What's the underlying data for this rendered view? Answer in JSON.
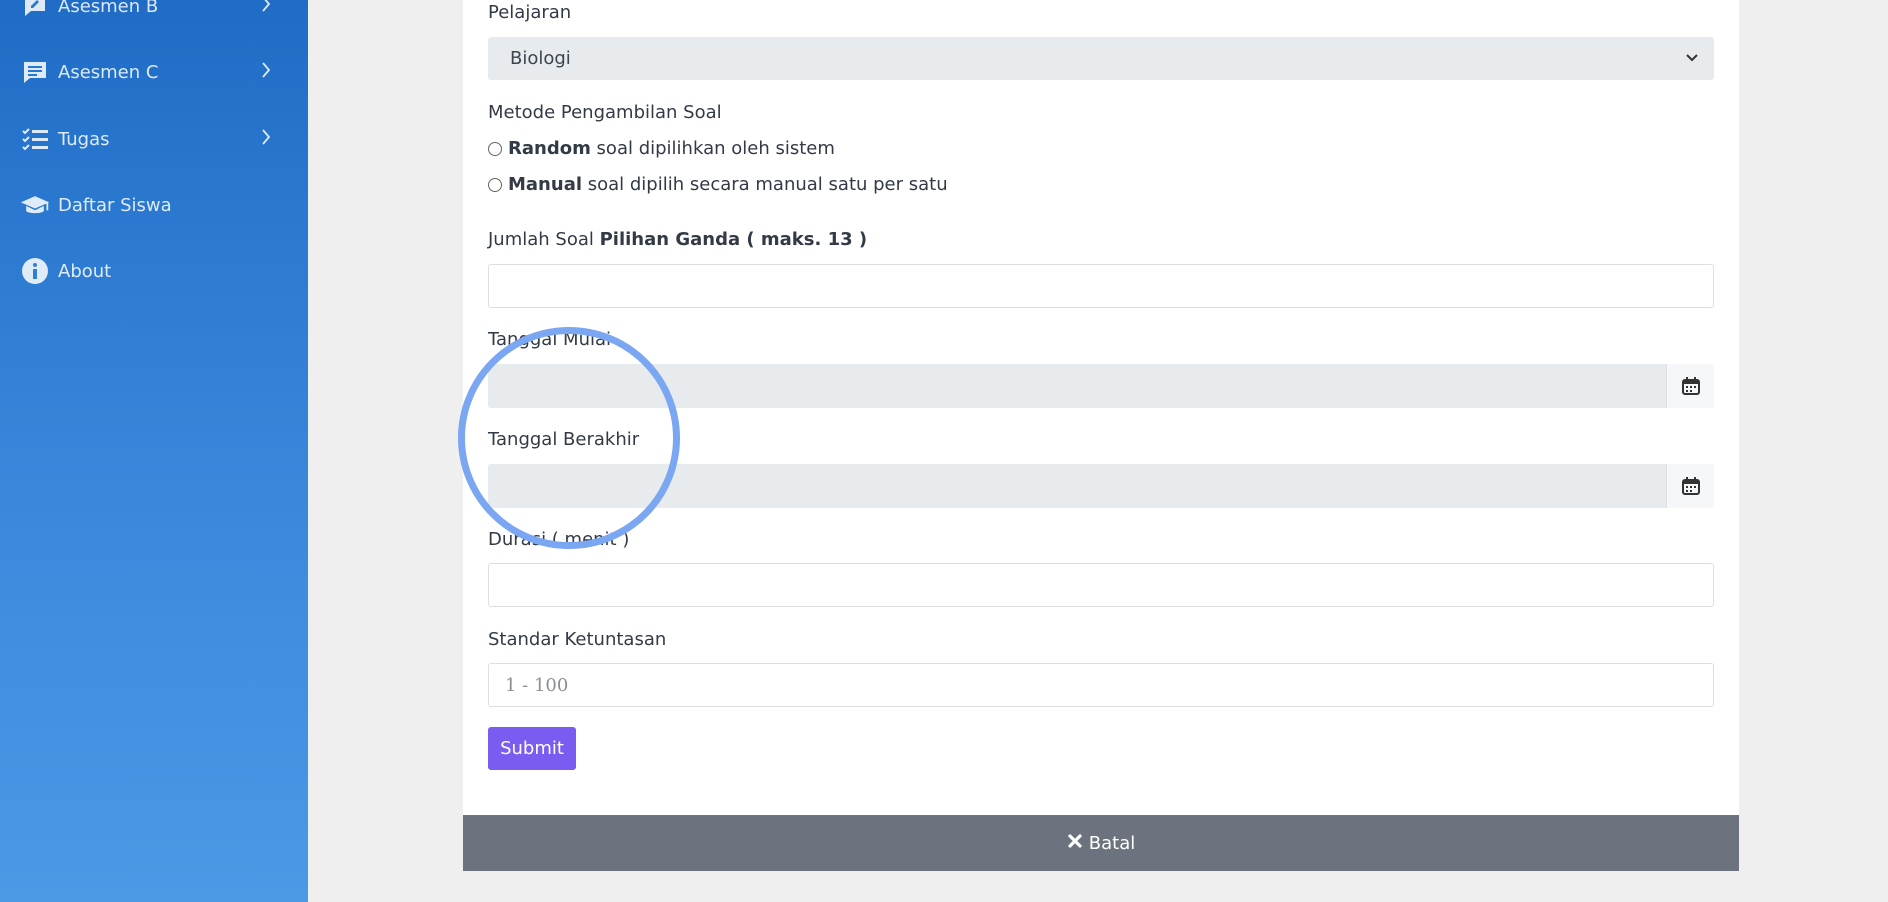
{
  "sidebar": {
    "items": [
      {
        "label": "Asesmen B",
        "icon": "edit-chat-icon",
        "has_chevron": true
      },
      {
        "label": "Asesmen C",
        "icon": "message-icon",
        "has_chevron": true
      },
      {
        "label": "Tugas",
        "icon": "checklist-icon",
        "has_chevron": true
      },
      {
        "label": "Daftar Siswa",
        "icon": "graduation-cap-icon",
        "has_chevron": false
      },
      {
        "label": "About",
        "icon": "info-icon",
        "has_chevron": false
      }
    ]
  },
  "form": {
    "pelajaran_label": "Pelajaran",
    "pelajaran_value": "Biologi",
    "metode_label": "Metode Pengambilan Soal",
    "radio_random_bold": "Random",
    "radio_random_text": " soal dipilihkan oleh sistem",
    "radio_manual_bold": "Manual",
    "radio_manual_text": " soal dipilih secara manual satu per satu",
    "jumlah_label_prefix": "Jumlah Soal ",
    "jumlah_label_bold": "Pilihan Ganda ( maks. 13 )",
    "jumlah_value": "",
    "tanggal_mulai_label": "Tanggal Mulai",
    "tanggal_berakhir_label": "Tanggal Berakhir",
    "durasi_label": "Durasi ( menit )",
    "durasi_value": "",
    "standar_label": "Standar Ketuntasan",
    "standar_placeholder": "1 - 100",
    "submit_label": "Submit",
    "cancel_label": "Batal"
  },
  "colors": {
    "sidebar_top": "#1f6cc6",
    "sidebar_bottom": "#4a9ae6",
    "submit": "#7b5cf0",
    "cancel_bar": "#6c737e",
    "highlight_ring": "#7aa6f2"
  }
}
